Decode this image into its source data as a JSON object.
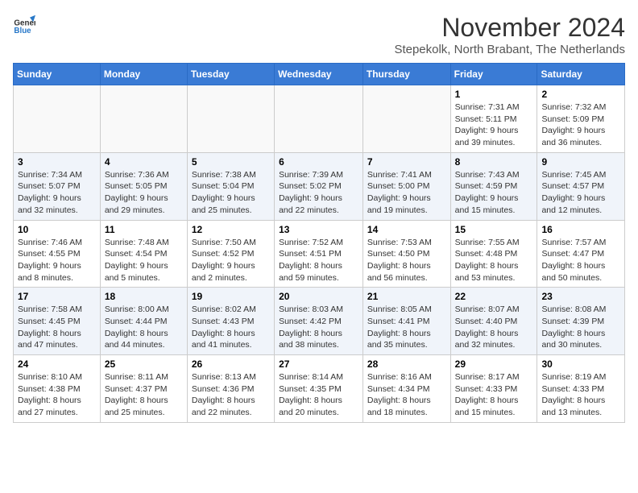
{
  "header": {
    "logo_general": "General",
    "logo_blue": "Blue",
    "month_title": "November 2024",
    "subtitle": "Stepekolk, North Brabant, The Netherlands"
  },
  "weekdays": [
    "Sunday",
    "Monday",
    "Tuesday",
    "Wednesday",
    "Thursday",
    "Friday",
    "Saturday"
  ],
  "weeks": [
    [
      {
        "day": "",
        "info": ""
      },
      {
        "day": "",
        "info": ""
      },
      {
        "day": "",
        "info": ""
      },
      {
        "day": "",
        "info": ""
      },
      {
        "day": "",
        "info": ""
      },
      {
        "day": "1",
        "info": "Sunrise: 7:31 AM\nSunset: 5:11 PM\nDaylight: 9 hours and 39 minutes."
      },
      {
        "day": "2",
        "info": "Sunrise: 7:32 AM\nSunset: 5:09 PM\nDaylight: 9 hours and 36 minutes."
      }
    ],
    [
      {
        "day": "3",
        "info": "Sunrise: 7:34 AM\nSunset: 5:07 PM\nDaylight: 9 hours and 32 minutes."
      },
      {
        "day": "4",
        "info": "Sunrise: 7:36 AM\nSunset: 5:05 PM\nDaylight: 9 hours and 29 minutes."
      },
      {
        "day": "5",
        "info": "Sunrise: 7:38 AM\nSunset: 5:04 PM\nDaylight: 9 hours and 25 minutes."
      },
      {
        "day": "6",
        "info": "Sunrise: 7:39 AM\nSunset: 5:02 PM\nDaylight: 9 hours and 22 minutes."
      },
      {
        "day": "7",
        "info": "Sunrise: 7:41 AM\nSunset: 5:00 PM\nDaylight: 9 hours and 19 minutes."
      },
      {
        "day": "8",
        "info": "Sunrise: 7:43 AM\nSunset: 4:59 PM\nDaylight: 9 hours and 15 minutes."
      },
      {
        "day": "9",
        "info": "Sunrise: 7:45 AM\nSunset: 4:57 PM\nDaylight: 9 hours and 12 minutes."
      }
    ],
    [
      {
        "day": "10",
        "info": "Sunrise: 7:46 AM\nSunset: 4:55 PM\nDaylight: 9 hours and 8 minutes."
      },
      {
        "day": "11",
        "info": "Sunrise: 7:48 AM\nSunset: 4:54 PM\nDaylight: 9 hours and 5 minutes."
      },
      {
        "day": "12",
        "info": "Sunrise: 7:50 AM\nSunset: 4:52 PM\nDaylight: 9 hours and 2 minutes."
      },
      {
        "day": "13",
        "info": "Sunrise: 7:52 AM\nSunset: 4:51 PM\nDaylight: 8 hours and 59 minutes."
      },
      {
        "day": "14",
        "info": "Sunrise: 7:53 AM\nSunset: 4:50 PM\nDaylight: 8 hours and 56 minutes."
      },
      {
        "day": "15",
        "info": "Sunrise: 7:55 AM\nSunset: 4:48 PM\nDaylight: 8 hours and 53 minutes."
      },
      {
        "day": "16",
        "info": "Sunrise: 7:57 AM\nSunset: 4:47 PM\nDaylight: 8 hours and 50 minutes."
      }
    ],
    [
      {
        "day": "17",
        "info": "Sunrise: 7:58 AM\nSunset: 4:45 PM\nDaylight: 8 hours and 47 minutes."
      },
      {
        "day": "18",
        "info": "Sunrise: 8:00 AM\nSunset: 4:44 PM\nDaylight: 8 hours and 44 minutes."
      },
      {
        "day": "19",
        "info": "Sunrise: 8:02 AM\nSunset: 4:43 PM\nDaylight: 8 hours and 41 minutes."
      },
      {
        "day": "20",
        "info": "Sunrise: 8:03 AM\nSunset: 4:42 PM\nDaylight: 8 hours and 38 minutes."
      },
      {
        "day": "21",
        "info": "Sunrise: 8:05 AM\nSunset: 4:41 PM\nDaylight: 8 hours and 35 minutes."
      },
      {
        "day": "22",
        "info": "Sunrise: 8:07 AM\nSunset: 4:40 PM\nDaylight: 8 hours and 32 minutes."
      },
      {
        "day": "23",
        "info": "Sunrise: 8:08 AM\nSunset: 4:39 PM\nDaylight: 8 hours and 30 minutes."
      }
    ],
    [
      {
        "day": "24",
        "info": "Sunrise: 8:10 AM\nSunset: 4:38 PM\nDaylight: 8 hours and 27 minutes."
      },
      {
        "day": "25",
        "info": "Sunrise: 8:11 AM\nSunset: 4:37 PM\nDaylight: 8 hours and 25 minutes."
      },
      {
        "day": "26",
        "info": "Sunrise: 8:13 AM\nSunset: 4:36 PM\nDaylight: 8 hours and 22 minutes."
      },
      {
        "day": "27",
        "info": "Sunrise: 8:14 AM\nSunset: 4:35 PM\nDaylight: 8 hours and 20 minutes."
      },
      {
        "day": "28",
        "info": "Sunrise: 8:16 AM\nSunset: 4:34 PM\nDaylight: 8 hours and 18 minutes."
      },
      {
        "day": "29",
        "info": "Sunrise: 8:17 AM\nSunset: 4:33 PM\nDaylight: 8 hours and 15 minutes."
      },
      {
        "day": "30",
        "info": "Sunrise: 8:19 AM\nSunset: 4:33 PM\nDaylight: 8 hours and 13 minutes."
      }
    ]
  ]
}
